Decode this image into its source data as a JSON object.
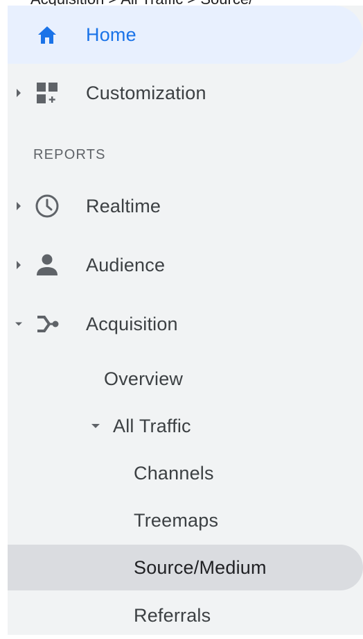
{
  "top_fragment": "Acquisition > All Traffic > Source/",
  "nav": {
    "home": {
      "label": "Home",
      "icon": "home-icon"
    },
    "customization": {
      "label": "Customization",
      "icon": "dashboard-add-icon"
    },
    "section_header": "REPORTS",
    "realtime": {
      "label": "Realtime",
      "icon": "clock-icon"
    },
    "audience": {
      "label": "Audience",
      "icon": "person-icon"
    },
    "acquisition": {
      "label": "Acquisition",
      "icon": "acquisition-icon",
      "expanded": true,
      "children": {
        "overview": "Overview",
        "all_traffic": {
          "label": "All Traffic",
          "expanded": true,
          "children": {
            "channels": "Channels",
            "treemaps": "Treemaps",
            "source_medium": "Source/Medium",
            "referrals": "Referrals"
          }
        }
      }
    },
    "selected": "Source/Medium"
  },
  "colors": {
    "sidebar_bg": "#f1f3f4",
    "home_bg": "#e8f0fe",
    "accent": "#1a73e8",
    "selected_bg": "#dadce0",
    "text": "#3c4043",
    "icon": "#5f6368"
  }
}
